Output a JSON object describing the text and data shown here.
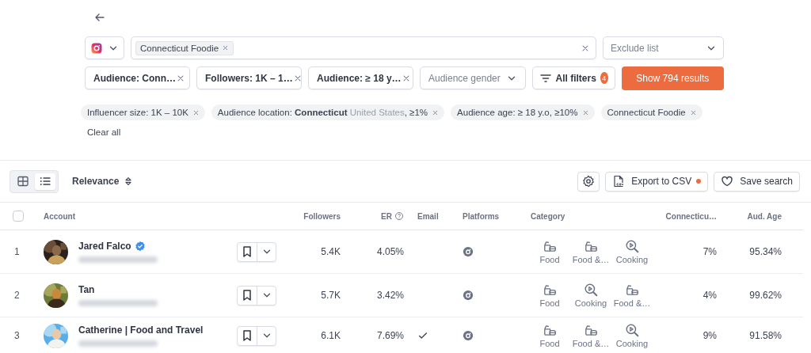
{
  "platform_select": {
    "kind": "instagram"
  },
  "search": {
    "tags": [
      "Connecticut Foodie"
    ]
  },
  "exclude_list": {
    "placeholder": "Exclude list"
  },
  "filters": [
    {
      "kind": "chip",
      "label": "Audience: Conn…"
    },
    {
      "kind": "chip",
      "label": "Followers: 1K – 1…"
    },
    {
      "kind": "chip",
      "label": "Audience: ≥ 18 y…"
    },
    {
      "kind": "dropdown",
      "label": "Audience gender"
    }
  ],
  "all_filters": {
    "label": "All filters",
    "count": "4"
  },
  "show_button": {
    "label": "Show 794 results"
  },
  "applied": [
    {
      "text": "Influencer size: 1K – 10K"
    },
    {
      "text": "Audience location: **Connecticut**",
      "detail": "United States",
      "suffix": ", ≥1%"
    },
    {
      "text": "Audience age: ≥ 18 y.o, ≥10%"
    },
    {
      "text": "Connecticut Foodie"
    }
  ],
  "clear_all": "Clear all",
  "view_toggle": [
    {
      "kind": "grid",
      "selected": false
    },
    {
      "kind": "list",
      "selected": true
    }
  ],
  "sort": {
    "label": "Relevance"
  },
  "export": {
    "label": "Export to CSV",
    "notification": true
  },
  "save_search": {
    "label": "Save search"
  },
  "table": {
    "select_all": {
      "checked": false
    },
    "columns": [
      {
        "label": "Account"
      },
      {
        "label": "Followers"
      },
      {
        "label": "ER",
        "help": true
      },
      {
        "label": "Email"
      },
      {
        "label": "Platforms"
      },
      {
        "label": "Category"
      },
      {
        "label": "Connecticu…"
      },
      {
        "label": "Aud. Age"
      }
    ],
    "rows": [
      {
        "number": "1",
        "name": "Jared Falco",
        "verified": true,
        "followers": "5.4K",
        "er": "4.05%",
        "email": false,
        "platforms": [
          {
            "kind": "instagram"
          }
        ],
        "categories": [
          {
            "kind": "food",
            "label": "Food"
          },
          {
            "kind": "food",
            "label": "Food &…"
          },
          {
            "kind": "cooking",
            "label": "Cooking"
          }
        ],
        "location_share": "7%",
        "aud_age": "95.34%"
      },
      {
        "number": "2",
        "name": "Tan",
        "verified": false,
        "followers": "5.7K",
        "er": "3.42%",
        "email": false,
        "platforms": [
          {
            "kind": "instagram"
          }
        ],
        "categories": [
          {
            "kind": "food",
            "label": "Food"
          },
          {
            "kind": "cooking",
            "label": "Cooking"
          },
          {
            "kind": "food",
            "label": "Food &…"
          }
        ],
        "location_share": "4%",
        "aud_age": "99.62%"
      },
      {
        "number": "3",
        "name": "Catherine | Food and Travel",
        "verified": false,
        "followers": "6.1K",
        "er": "7.69%",
        "email": true,
        "platforms": [
          {
            "kind": "instagram"
          }
        ],
        "categories": [
          {
            "kind": "food",
            "label": "Food"
          },
          {
            "kind": "food",
            "label": "Food &…"
          },
          {
            "kind": "cooking",
            "label": "Cooking"
          }
        ],
        "location_share": "9%",
        "aud_age": "91.58%"
      }
    ]
  }
}
